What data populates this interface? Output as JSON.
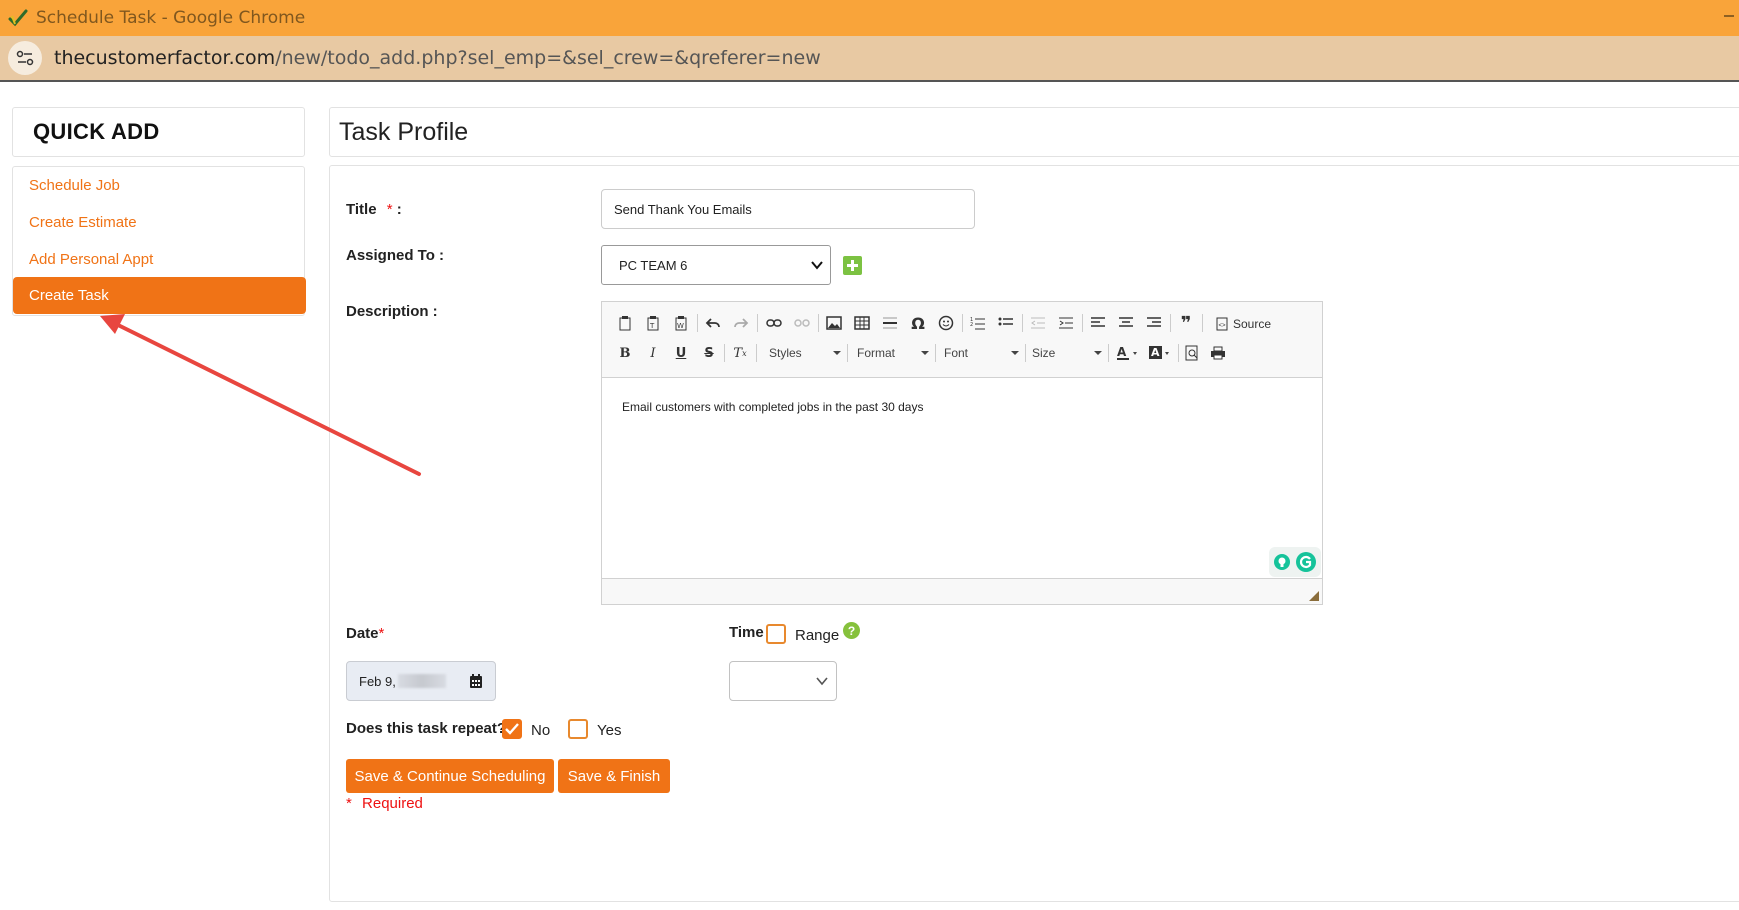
{
  "window": {
    "title": "Schedule Task - Google Chrome"
  },
  "address_bar": {
    "host": "thecustomerfactor.com",
    "path": "/new/todo_add.php?sel_emp=&sel_crew=&qreferer=new"
  },
  "sidebar": {
    "heading": "QUICK ADD",
    "items": [
      {
        "label": "Schedule Job"
      },
      {
        "label": "Create Estimate"
      },
      {
        "label": "Add Personal Appt"
      },
      {
        "label": "Create Task",
        "active": true
      }
    ]
  },
  "main": {
    "heading": "Task Profile",
    "title_field": {
      "label": "Title",
      "required_mark": "*",
      "colon": ":",
      "value": "Send Thank You Emails"
    },
    "assigned_to": {
      "label": "Assigned To :",
      "value": "PC TEAM 6"
    },
    "description": {
      "label": "Description :",
      "toolbar": {
        "styles": "Styles",
        "format": "Format",
        "font": "Font",
        "size": "Size",
        "source": "Source"
      },
      "content": "Email customers with completed jobs in the past 30 days"
    },
    "date": {
      "label": "Date",
      "required_mark": "*",
      "value": "Feb 9,"
    },
    "time": {
      "label": "Time",
      "range_label": "Range",
      "help": "?",
      "value": ""
    },
    "repeat": {
      "question": "Does this task repeat?",
      "no_label": "No",
      "yes_label": "Yes",
      "selected": "No"
    },
    "buttons": {
      "save_continue": "Save & Continue Scheduling",
      "save_finish": "Save & Finish"
    },
    "required_note_mark": "*",
    "required_note": "Required"
  },
  "colors": {
    "accent": "#f07316",
    "titlebar": "#f9a43a",
    "address_bar": "#e8c9a3",
    "add_button": "#7cc242",
    "annotation_arrow": "#e8463f"
  }
}
